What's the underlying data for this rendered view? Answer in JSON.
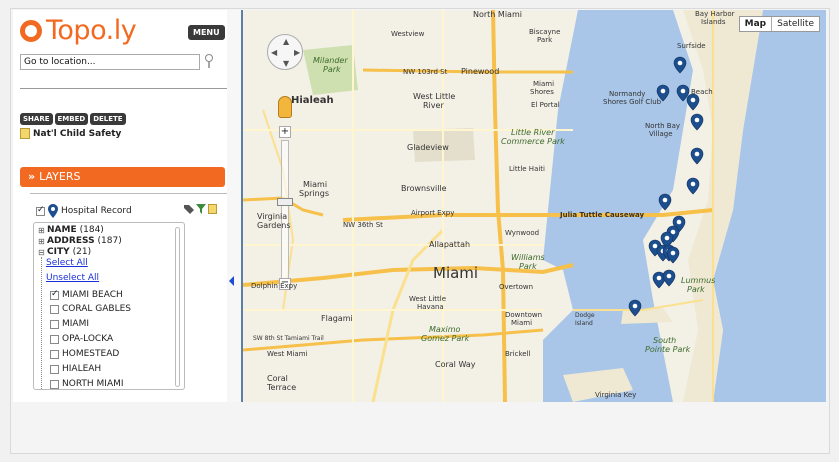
{
  "app": {
    "logo": "Topo.ly",
    "menu_label": "MENU"
  },
  "search": {
    "value": "Go to location..."
  },
  "actions": [
    "SHARE",
    "EMBED",
    "DELETE"
  ],
  "map_name": "Nat'l Child Safety",
  "layers": {
    "header": "LAYERS",
    "layer_name": "Hospital Record"
  },
  "tree": {
    "groups": [
      {
        "name": "NAME",
        "count": "(184)"
      },
      {
        "name": "ADDRESS",
        "count": "(187)"
      },
      {
        "name": "CITY",
        "count": "(21)"
      }
    ],
    "select_all": "Select All",
    "unselect_all": "Unselect All",
    "cities": [
      {
        "label": "MIAMI BEACH",
        "checked": true
      },
      {
        "label": "CORAL GABLES",
        "checked": false
      },
      {
        "label": "MIAMI",
        "checked": false
      },
      {
        "label": "OPA-LOCKA",
        "checked": false
      },
      {
        "label": "HOMESTEAD",
        "checked": false
      },
      {
        "label": "HIALEAH",
        "checked": false
      },
      {
        "label": "NORTH MIAMI",
        "checked": false
      }
    ]
  },
  "map": {
    "type_buttons": [
      "Map",
      "Satellite"
    ],
    "active_type": "Map",
    "labels": {
      "north_miami": "North Miami",
      "bay_harbor": "Bay Harbor",
      "islands": "Islands",
      "surfside": "Surfside",
      "westview": "Westview",
      "biscayne_park": "Biscayne",
      "biscayne_park2": "Park",
      "milander": "Milander",
      "milander2": "Park",
      "nw103": "NW 103rd St",
      "pinewood": "Pinewood",
      "miami_shores": "Miami",
      "miami_shores2": "Shores",
      "hialeah": "Hialeah",
      "wlr": "West Little",
      "wlr2": "River",
      "el_portal": "El Portal",
      "normandy": "Normandy",
      "normandy2": "Shores Golf Club",
      "north_bay": "North Bay",
      "north_bay2": "Village",
      "little_river": "Little River",
      "little_river2": "Commerce Park",
      "gladeview": "Gladeview",
      "little_haiti": "Little Haiti",
      "miami_springs": "Miami",
      "miami_springs2": "Springs",
      "brownsville": "Brownsville",
      "virginia": "Virginia",
      "virginia2": "Gardens",
      "nw36": "NW 36th St",
      "airport_expy": "Airport Expy",
      "julia_tuttle": "Julia Tuttle Causeway",
      "wynwood": "Wynwood",
      "allapattah": "Allapattah",
      "williams": "Williams",
      "williams2": "Park",
      "miami": "Miami",
      "overtown": "Overtown",
      "dolphin": "Dolphin Expy",
      "wlh": "West Little",
      "wlh2": "Havana",
      "downtown": "Downtown",
      "downtown2": "Miami",
      "dodge": "Dodge",
      "dodge2": "Island",
      "flagami": "Flagami",
      "maximo": "Maximo",
      "maximo2": "Gomez Park",
      "tamiami": "SW 8th St  Tamiami Trail",
      "west_miami": "West Miami",
      "coral_way": "Coral Way",
      "brickell": "Brickell",
      "south_pointe": "South",
      "south_pointe2": "Pointe Park",
      "lummus": "Lummus",
      "lummus2": "Park",
      "coral_terrace": "Coral",
      "coral_terrace2": "Terrace",
      "virginia_key": "Virginia Key",
      "e8th": "E 8th Ave",
      "se8th": "SE 8th Ave",
      "beach": "Beach",
      "north_rd": "Rd"
    },
    "shields": [
      "823",
      "5",
      "A1A",
      "934",
      "907",
      "112",
      "27",
      "195",
      "948",
      "836",
      "959",
      "7",
      "90",
      "41",
      "953",
      "1",
      "913"
    ]
  },
  "colors": {
    "accent": "#f26a21",
    "water": "#a9c6e8",
    "marker": "#1d4f8f"
  }
}
